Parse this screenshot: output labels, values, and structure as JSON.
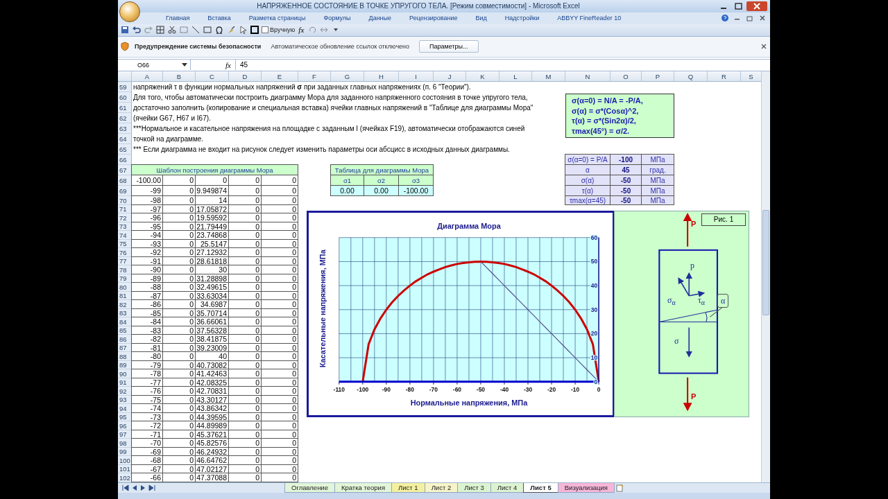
{
  "window": {
    "title": "НАПРЯЖЕННОЕ СОСТОЯНИЕ В ТОЧКЕ УПРУГОГО ТЕЛА.  [Режим совместимости] - Microsoft Excel"
  },
  "ribbon_tabs": [
    {
      "label": "Главная",
      "selected": false
    },
    {
      "label": "Вставка",
      "selected": false
    },
    {
      "label": "Разметка страницы",
      "selected": false
    },
    {
      "label": "Формулы",
      "selected": false
    },
    {
      "label": "Данные",
      "selected": false
    },
    {
      "label": "Рецензирование",
      "selected": false
    },
    {
      "label": "Вид",
      "selected": false
    },
    {
      "label": "Надстройки",
      "selected": false
    },
    {
      "label": "ABBYY FineReader 10",
      "selected": false
    }
  ],
  "toolbar": {
    "manual_checkbox": {
      "label": "Вручную",
      "checked": false
    },
    "function_label": "fx"
  },
  "security_bar": {
    "title": "Предупреждение системы безопасности",
    "message": "Автоматическое обновление ссылок отключено",
    "button": "Параметры..."
  },
  "formula_bar": {
    "cell": "O66",
    "function_label": "fx",
    "value": "45"
  },
  "column_headers": [
    "A",
    "B",
    "C",
    "D",
    "E",
    "F",
    "G",
    "H",
    "I",
    "J",
    "K",
    "L",
    "M",
    "N",
    "O",
    "P",
    "Q",
    "R",
    "S"
  ],
  "row_numbers": [
    "59",
    "60",
    "61",
    "62",
    "63",
    "64",
    "65",
    "66",
    "67",
    "68",
    "69",
    "70",
    "71",
    "72",
    "73",
    "74",
    "75",
    "76",
    "77",
    "78",
    "79",
    "80",
    "81",
    "82",
    "83",
    "84",
    "85",
    "86",
    "87",
    "88",
    "89",
    "90",
    "91",
    "92",
    "93",
    "94",
    "95",
    "96",
    "97",
    "98",
    "99",
    "100",
    "101",
    "102"
  ],
  "notes": [
    "напряжений τ в функции нормальных напряжений  **σ** при заданных главных напряжениях (п. 6 \"Теории\").",
    "Для того, чтобы автоматически построить диаграмму Мора для заданного напряженного состояния в точке упругого тела,",
    "достаточно заполнить (копирование и специальная вставка) ячейки главных напряжений в \"Таблице для диаграммы Мора\"",
    "(ячейки G67, H67 и I67).",
    "***Нормальное и касательное напряжения на площадке с заданным I  (ячейках F19), автоматически отображаются синей",
    "точкой на диаграмме.",
    "*** Если диаграмма не входит на рисунок следует изменить параметры оси абсцисс в исходных данных диаграммы."
  ],
  "formula_box": [
    "σ(α=0) = N/A = -P/A,",
    "σ(α) = σ*(Cosα)^2,",
    "τ(α) = σ*(Sin2α)/2,",
    "τmax(45°) = σ/2."
  ],
  "results_table": [
    [
      "σ(α=0) = P/A",
      "-100",
      "МПа"
    ],
    [
      "α",
      "45",
      "град."
    ],
    [
      "σ(α)",
      "-50",
      "МПа"
    ],
    [
      "τ(α)",
      "-50",
      "МПа"
    ],
    [
      "τmax(α=45)",
      "-50",
      "МПа"
    ]
  ],
  "template_table": {
    "title": "Шаблон построения диаграммы Мора",
    "rows": [
      [
        "-100.00",
        "0",
        "0",
        "0",
        "0"
      ],
      [
        "-99",
        "0",
        "9.949874",
        "0",
        "0"
      ],
      [
        "-98",
        "0",
        "14",
        "0",
        "0"
      ],
      [
        "-97",
        "0",
        "17.05872",
        "0",
        "0"
      ],
      [
        "-96",
        "0",
        "19.59592",
        "0",
        "0"
      ],
      [
        "-95",
        "0",
        "21.79449",
        "0",
        "0"
      ],
      [
        "-94",
        "0",
        "23.74868",
        "0",
        "0"
      ],
      [
        "-93",
        "0",
        "25.5147",
        "0",
        "0"
      ],
      [
        "-92",
        "0",
        "27.12932",
        "0",
        "0"
      ],
      [
        "-91",
        "0",
        "28.61818",
        "0",
        "0"
      ],
      [
        "-90",
        "0",
        "30",
        "0",
        "0"
      ],
      [
        "-89",
        "0",
        "31.28898",
        "0",
        "0"
      ],
      [
        "-88",
        "0",
        "32.49615",
        "0",
        "0"
      ],
      [
        "-87",
        "0",
        "33.63034",
        "0",
        "0"
      ],
      [
        "-86",
        "0",
        "34.6987",
        "0",
        "0"
      ],
      [
        "-85",
        "0",
        "35.70714",
        "0",
        "0"
      ],
      [
        "-84",
        "0",
        "36.66061",
        "0",
        "0"
      ],
      [
        "-83",
        "0",
        "37.56328",
        "0",
        "0"
      ],
      [
        "-82",
        "0",
        "38.41875",
        "0",
        "0"
      ],
      [
        "-81",
        "0",
        "39.23009",
        "0",
        "0"
      ],
      [
        "-80",
        "0",
        "40",
        "0",
        "0"
      ],
      [
        "-79",
        "0",
        "40.73082",
        "0",
        "0"
      ],
      [
        "-78",
        "0",
        "41.42463",
        "0",
        "0"
      ],
      [
        "-77",
        "0",
        "42.08325",
        "0",
        "0"
      ],
      [
        "-76",
        "0",
        "42.70831",
        "0",
        "0"
      ],
      [
        "-75",
        "0",
        "43.30127",
        "0",
        "0"
      ],
      [
        "-74",
        "0",
        "43.86342",
        "0",
        "0"
      ],
      [
        "-73",
        "0",
        "44.39595",
        "0",
        "0"
      ],
      [
        "-72",
        "0",
        "44.89989",
        "0",
        "0"
      ],
      [
        "-71",
        "0",
        "45.37621",
        "0",
        "0"
      ],
      [
        "-70",
        "0",
        "45.82576",
        "0",
        "0"
      ],
      [
        "-69",
        "0",
        "46.24932",
        "0",
        "0"
      ],
      [
        "-68",
        "0",
        "46.64762",
        "0",
        "0"
      ],
      [
        "-67",
        "0",
        "47.02127",
        "0",
        "0"
      ],
      [
        "-66",
        "0",
        "47.37088",
        "0",
        "0"
      ]
    ]
  },
  "mohr_table": {
    "title": "Таблица для диаграммы Мора",
    "headers": [
      "σ1",
      "σ2",
      "σ3"
    ],
    "values": [
      "0.00",
      "0.00",
      "-100.00"
    ]
  },
  "chart": {
    "chart_data": {
      "type": "line",
      "title": "Диаграмма Мора",
      "xlabel": "Нормальные напряжения, МПа",
      "ylabel": "Касательные напряжения, МПа",
      "x": [
        -100,
        -97.5,
        -95,
        -92.5,
        -90,
        -87.5,
        -85,
        -82.5,
        -80,
        -77.5,
        -75,
        -72.5,
        -70,
        -67.5,
        -65,
        -62.5,
        -60,
        -57.5,
        -55,
        -52.5,
        -50,
        -47.5,
        -45,
        -42.5,
        -40,
        -37.5,
        -35,
        -32.5,
        -30,
        -27.5,
        -25,
        -22.5,
        -20,
        -17.5,
        -15,
        -12.5,
        -10,
        -7.5,
        -5,
        -2.5,
        0
      ],
      "grid": true,
      "series": [
        {
          "color": "#cc0000",
          "values": [
            0,
            15.6,
            21.8,
            26.3,
            30,
            33.1,
            35.7,
            38,
            40,
            41.8,
            43.3,
            44.7,
            45.8,
            46.8,
            47.7,
            48.4,
            49,
            49.4,
            49.7,
            49.9,
            50,
            49.9,
            49.7,
            49.4,
            49,
            48.4,
            47.7,
            46.8,
            45.8,
            44.7,
            43.3,
            41.8,
            40,
            38,
            35.7,
            33.1,
            30,
            26.3,
            21.8,
            15.6,
            0
          ]
        },
        {
          "color": "#5a4f8c",
          "values": [
            null,
            null,
            null,
            null,
            null,
            null,
            null,
            null,
            null,
            null,
            null,
            null,
            null,
            null,
            null,
            null,
            null,
            null,
            null,
            null,
            50,
            47.5,
            45,
            42.5,
            40,
            37.5,
            35,
            32.5,
            30,
            27.5,
            25,
            22.5,
            20,
            17.5,
            15,
            12.5,
            10,
            7.5,
            5,
            2.5,
            0
          ]
        }
      ],
      "xlim": [
        -110,
        0
      ],
      "ylim": [
        0,
        60
      ],
      "xticks": [
        -110,
        -100,
        -90,
        -80,
        -70,
        -60,
        -50,
        -40,
        -30,
        -20,
        -10,
        0
      ],
      "yticks": [
        0,
        10,
        20,
        30,
        40,
        50,
        60
      ]
    }
  },
  "figure": {
    "caption": "Рис. 1",
    "force_labels": [
      "P",
      "P"
    ],
    "vector_labels": [
      "p",
      "σ$_{α}$",
      "τ$_{α}$",
      "σ"
    ],
    "angle_label": "α"
  },
  "sheet_tabs": [
    {
      "label": "Оглавление",
      "selected": false,
      "color": "#e2f5d8"
    },
    {
      "label": "Кратка теория",
      "selected": false,
      "color": "#e2f5d8"
    },
    {
      "label": "Лист 1",
      "selected": false,
      "color": "#f5f0a0"
    },
    {
      "label": "Лист 2",
      "selected": false,
      "color": "#f7f4c8"
    },
    {
      "label": "Лист 3",
      "selected": false,
      "color": "#dcf3d0"
    },
    {
      "label": "Лист 4",
      "selected": false,
      "color": "#dcf3d0"
    },
    {
      "label": "Лист 5",
      "selected": true,
      "color": "#ffffff"
    },
    {
      "label": "Визуализация",
      "selected": false,
      "color": "#f6b6d8"
    }
  ]
}
